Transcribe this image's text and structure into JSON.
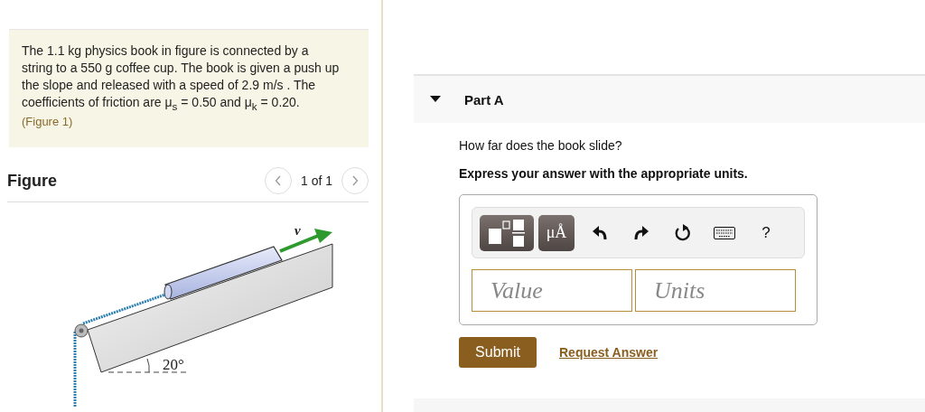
{
  "problem": {
    "text": "The 1.1 kg physics book in figure is connected by a string to a 550 g coffee cup. The book is given a push up the slope and released with a speed of 2.9 m/s . The coefficients of friction are μ$_{s}$ = 0.50 and μ$_{k}$ = 0.20.",
    "link": "(Figure 1)"
  },
  "figure": {
    "title": "Figure",
    "pager": "1 of 1",
    "vector_label": "v⃗",
    "angle_label": "20°"
  },
  "part": {
    "title": "Part A",
    "expanded": true,
    "question": "How far does the book slide?",
    "instruction": "Express your answer with the appropriate units.",
    "toolbar": [
      {
        "kind": "template"
      },
      {
        "kind": "units",
        "label": "μÅ"
      },
      {
        "kind": "undo"
      },
      {
        "kind": "redo"
      },
      {
        "kind": "reset"
      },
      {
        "kind": "keyboard"
      },
      {
        "kind": "help",
        "label": "?"
      }
    ],
    "value_placeholder": "Value",
    "units_placeholder": "Units",
    "submit": "Submit",
    "request": "Request Answer"
  }
}
